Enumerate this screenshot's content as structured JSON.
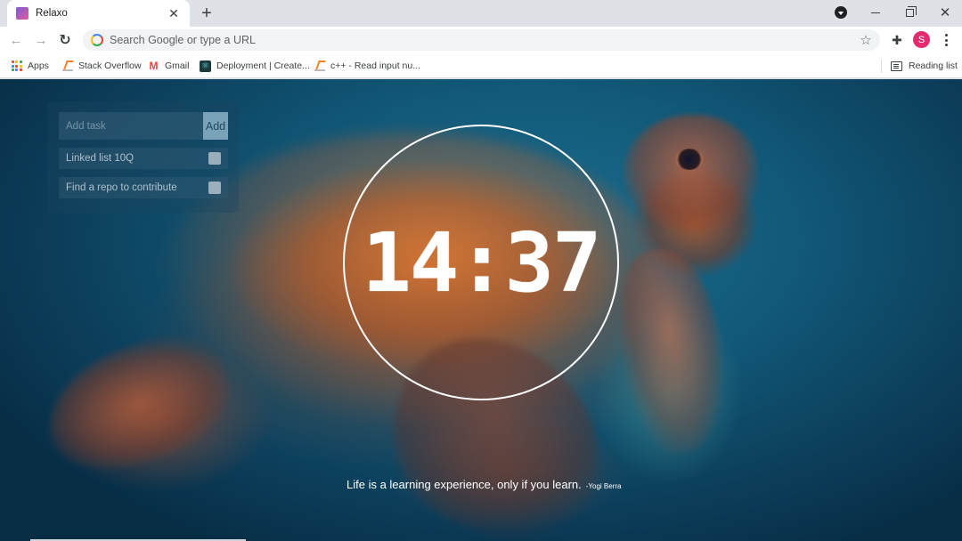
{
  "browser": {
    "tab_title": "Relaxo",
    "omnibox_placeholder": "Search Google or type a URL",
    "profile_initial": "S",
    "bookmarks": [
      {
        "label": "Apps",
        "icon": "apps-grid-icon"
      },
      {
        "label": "Stack Overflow",
        "icon": "stackoverflow-icon"
      },
      {
        "label": "Gmail",
        "icon": "gmail-icon"
      },
      {
        "label": "Deployment | Create...",
        "icon": "react-icon"
      },
      {
        "label": "c++ - Read input nu...",
        "icon": "stackoverflow-icon"
      }
    ],
    "reading_list": "Reading list"
  },
  "tasks": {
    "input_placeholder": "Add task",
    "add_label": "Add",
    "items": [
      {
        "label": "Linked list 10Q",
        "done": false
      },
      {
        "label": "Find a repo to contribute",
        "done": false
      }
    ]
  },
  "clock": {
    "time": "14:37"
  },
  "quote": {
    "text": "Life is a learning experience, only if you learn.",
    "author": "-Yogi Berra"
  },
  "colors": {
    "accent_avatar": "#e52a6f",
    "add_button": "#7aa2b8",
    "clock_ring": "#ffffff"
  }
}
